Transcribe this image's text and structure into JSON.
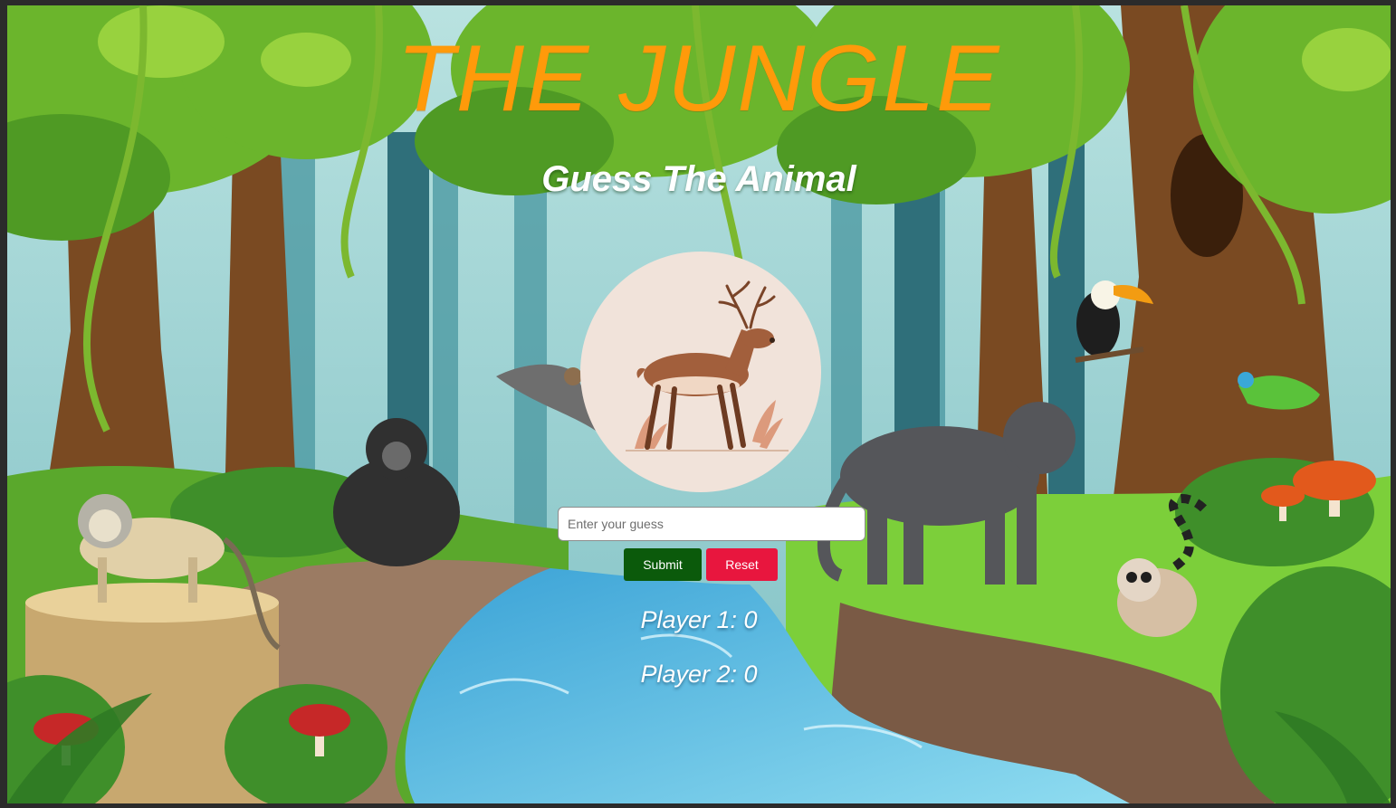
{
  "game": {
    "title": "THE JUNGLE",
    "subtitle": "Guess The Animal",
    "current_animal_icon": "deer-illustration",
    "guess_placeholder": "Enter your guess",
    "guess_value": "",
    "submit_label": "Submit",
    "reset_label": "Reset",
    "scores": [
      {
        "label": "Player 1: 0",
        "value": 0
      },
      {
        "label": "Player 2: 0",
        "value": 0
      }
    ]
  },
  "colors": {
    "title": "#ff9a0a",
    "submit": "#0b5a0b",
    "reset": "#e8163e",
    "card_background": "#f1e3da"
  },
  "background": {
    "icons": [
      "jungle-background",
      "monkey-icon",
      "gorilla-icon",
      "panther-icon",
      "toucan-icon",
      "lemur-icon",
      "chameleon-icon",
      "bat-icon",
      "river-icon",
      "mushroom-icon"
    ]
  }
}
